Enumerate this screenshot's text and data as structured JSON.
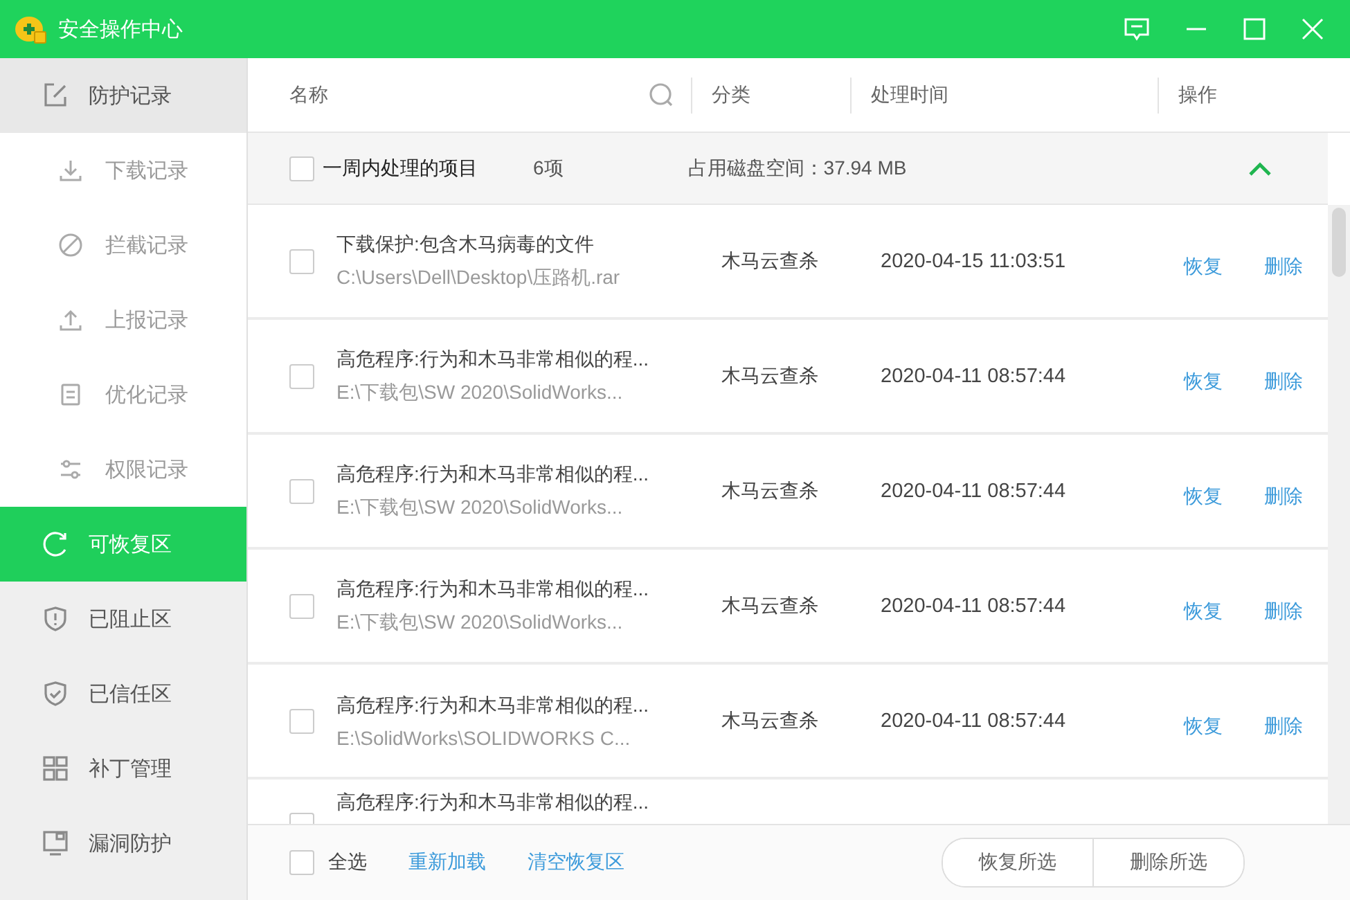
{
  "window": {
    "title": "安全操作中心"
  },
  "sidebar": {
    "items": [
      {
        "label": "防护记录",
        "selected": false,
        "expanded": true,
        "children": [
          {
            "label": "下载记录",
            "selected": false
          },
          {
            "label": "拦截记录",
            "selected": false
          },
          {
            "label": "上报记录",
            "selected": false
          },
          {
            "label": "优化记录",
            "selected": false
          },
          {
            "label": "权限记录",
            "selected": false
          }
        ]
      },
      {
        "label": "可恢复区",
        "selected": true
      },
      {
        "label": "已阻止区",
        "selected": false
      },
      {
        "label": "已信任区",
        "selected": false
      },
      {
        "label": "补丁管理",
        "selected": false
      },
      {
        "label": "漏洞防护",
        "selected": false
      }
    ]
  },
  "table": {
    "columns": [
      "名称",
      "分类",
      "处理时间",
      "操作"
    ],
    "group": {
      "label": "一周内处理的项目",
      "checked": false,
      "count": "6项",
      "disk_usage": "占用磁盘空间：37.94 MB",
      "expanded": true
    },
    "rows": [
      {
        "name": "下载保护:包含木马病毒的文件",
        "path": "C:\\Users\\Dell\\Desktop\\压路机.rar",
        "category": "木马云查杀",
        "time": "2020-04-15 11:03:51",
        "actions": [
          "恢复",
          "删除"
        ],
        "checked": false
      },
      {
        "name": "高危程序:行为和木马非常相似的程...",
        "path": "E:\\下载包\\SW 2020\\SolidWorks...",
        "category": "木马云查杀",
        "time": "2020-04-11 08:57:44",
        "actions": [
          "恢复",
          "删除"
        ],
        "checked": false
      },
      {
        "name": "高危程序:行为和木马非常相似的程...",
        "path": "E:\\下载包\\SW 2020\\SolidWorks...",
        "category": "木马云查杀",
        "time": "2020-04-11 08:57:44",
        "actions": [
          "恢复",
          "删除"
        ],
        "checked": false
      },
      {
        "name": "高危程序:行为和木马非常相似的程...",
        "path": "E:\\下载包\\SW 2020\\SolidWorks...",
        "category": "木马云查杀",
        "time": "2020-04-11 08:57:44",
        "actions": [
          "恢复",
          "删除"
        ],
        "checked": false
      },
      {
        "name": "高危程序:行为和木马非常相似的程...",
        "path": "E:\\SolidWorks\\SOLIDWORKS C...",
        "category": "木马云查杀",
        "time": "2020-04-11 08:57:44",
        "actions": [
          "恢复",
          "删除"
        ],
        "checked": false
      },
      {
        "name": "高危程序:行为和木马非常相似的程...",
        "checked": false
      }
    ]
  },
  "footer": {
    "select_all": {
      "label": "全选",
      "checked": false
    },
    "links": [
      "重新加载",
      "清空恢复区"
    ],
    "buttons": [
      "恢复所选",
      "删除所选"
    ]
  }
}
